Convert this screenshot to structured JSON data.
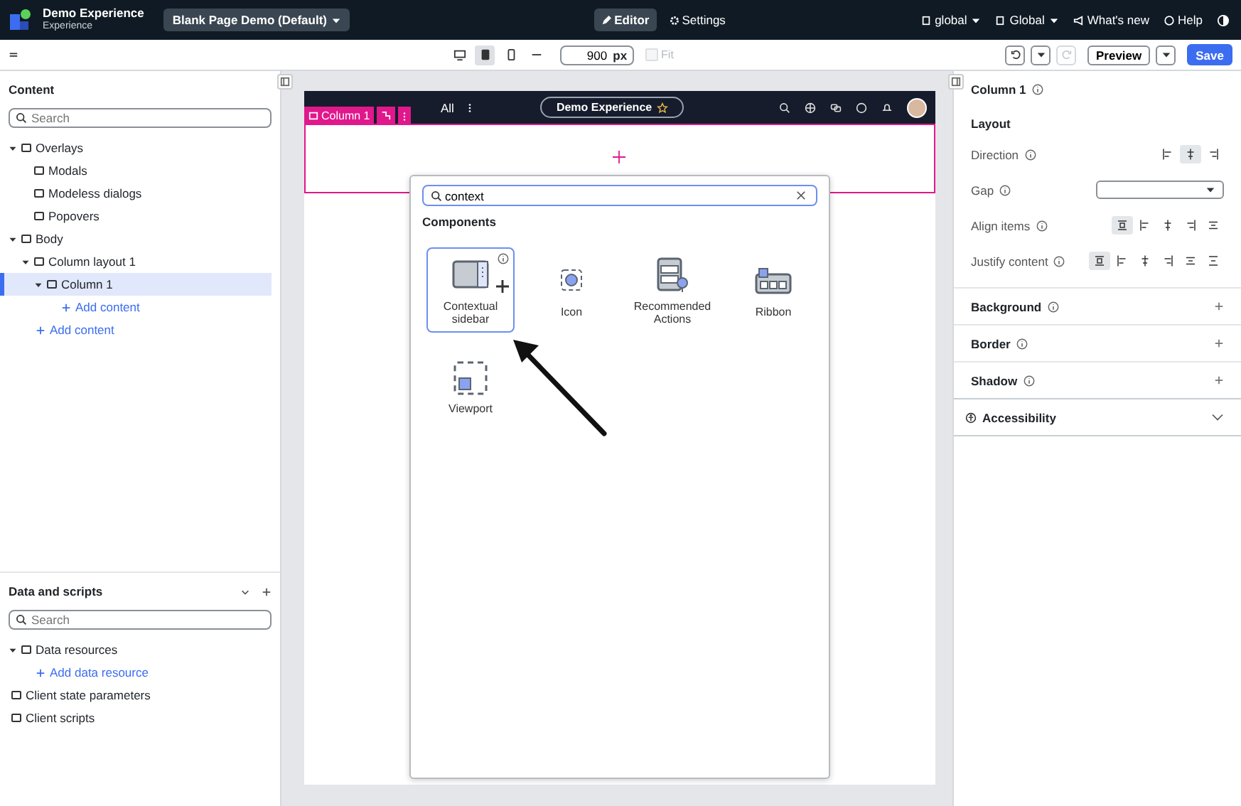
{
  "header": {
    "app_title": "Demo Experience",
    "app_subtitle": "Experience",
    "page_select": "Blank Page Demo (Default)",
    "modes": [
      {
        "label": "Editor",
        "selected": true
      },
      {
        "label": "Settings",
        "selected": false
      }
    ],
    "scope_menus": [
      "global",
      "Global"
    ],
    "links": [
      "What's new",
      "Help"
    ]
  },
  "toolbar": {
    "devices": [
      {
        "kind": "desktop",
        "selected": false
      },
      {
        "kind": "tablet",
        "selected": true
      },
      {
        "kind": "mobile",
        "selected": false
      },
      {
        "kind": "custom",
        "selected": false
      }
    ],
    "width_value": "900",
    "width_unit": "px",
    "fit": {
      "label": "Fit",
      "checked": false,
      "disabled": true
    },
    "redo_disabled": true,
    "preview": "Preview",
    "save": "Save"
  },
  "content_panel": {
    "title": "Content",
    "search_placeholder": "Search",
    "tree": [
      {
        "label": "Overlays",
        "kind": "node",
        "selected": false,
        "expanded": true,
        "children": [
          {
            "label": "Modals",
            "kind": "node",
            "selected": false
          },
          {
            "label": "Modeless dialogs",
            "kind": "node",
            "selected": false
          },
          {
            "label": "Popovers",
            "kind": "node",
            "selected": false
          }
        ]
      },
      {
        "label": "Body",
        "kind": "node",
        "selected": false,
        "expanded": true,
        "children": [
          {
            "label": "Column layout 1",
            "kind": "node",
            "selected": false,
            "expanded": true,
            "children": [
              {
                "label": "Column 1",
                "kind": "node",
                "selected": true,
                "expanded": true,
                "children": [
                  {
                    "label": "Add content",
                    "kind": "add",
                    "selected": false
                  }
                ]
              }
            ]
          },
          {
            "label": "Add content",
            "kind": "add",
            "selected": false
          }
        ]
      }
    ]
  },
  "data_panel": {
    "title": "Data and scripts",
    "search_placeholder": "Search",
    "tree": [
      {
        "label": "Data resources",
        "kind": "node",
        "selected": false,
        "expanded": true,
        "children": [
          {
            "label": "Add data resource",
            "kind": "add",
            "selected": false
          }
        ]
      },
      {
        "label": "Client state parameters",
        "kind": "plain",
        "selected": false
      },
      {
        "label": "Client scripts",
        "kind": "plain",
        "selected": false
      }
    ]
  },
  "canvas": {
    "nav": {
      "all": "All",
      "experience": "Demo Experience"
    },
    "column_tag": "Column 1",
    "picker": {
      "search_value": "context",
      "section": "Components",
      "components": [
        {
          "label": "Contextual sidebar",
          "kind": "sidebar",
          "selected": true
        },
        {
          "label": "Icon",
          "kind": "icon",
          "selected": false
        },
        {
          "label": "Recommended Actions",
          "kind": "actions",
          "selected": false
        },
        {
          "label": "Ribbon",
          "kind": "ribbon",
          "selected": false
        },
        {
          "label": "Viewport",
          "kind": "viewport",
          "selected": false
        }
      ]
    }
  },
  "properties": {
    "title": "Column 1",
    "section": "Layout",
    "direction": {
      "label": "Direction",
      "options": [
        {
          "selected": false
        },
        {
          "selected": true
        },
        {
          "selected": false
        }
      ]
    },
    "gap": {
      "label": "Gap"
    },
    "align_items": {
      "label": "Align items",
      "options": [
        {
          "selected": true
        },
        {
          "selected": false
        },
        {
          "selected": false
        },
        {
          "selected": false
        },
        {
          "selected": false
        }
      ]
    },
    "justify_content": {
      "label": "Justify content",
      "options": [
        {
          "selected": true
        },
        {
          "selected": false
        },
        {
          "selected": false
        },
        {
          "selected": false
        },
        {
          "selected": false
        },
        {
          "selected": false
        }
      ]
    },
    "groups": [
      {
        "label": "Background",
        "kind": "add"
      },
      {
        "label": "Border",
        "kind": "add"
      },
      {
        "label": "Shadow",
        "kind": "add"
      },
      {
        "label": "Accessibility",
        "kind": "expand",
        "expanded": false
      }
    ]
  }
}
